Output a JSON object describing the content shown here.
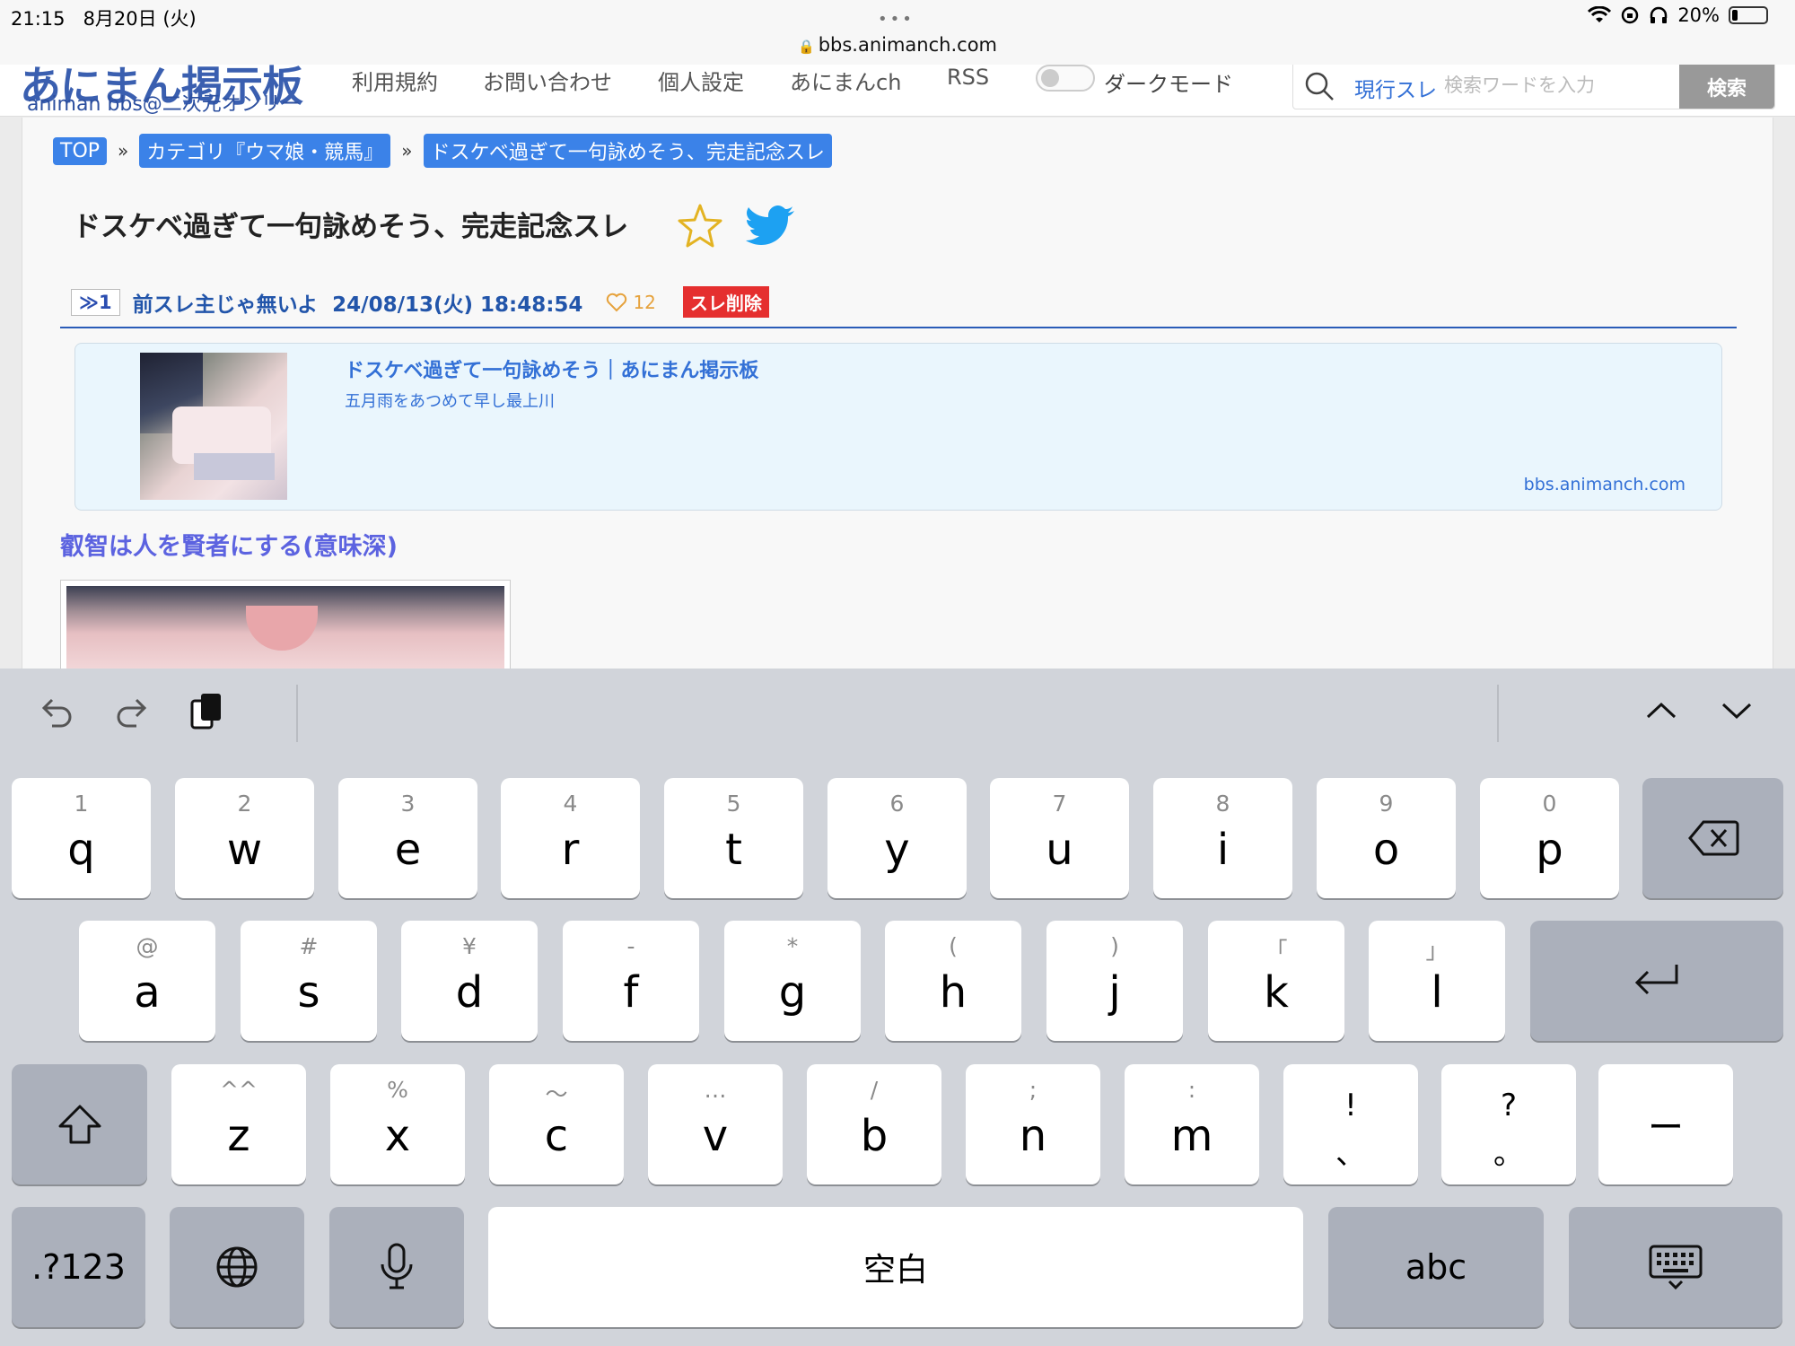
{
  "status_bar": {
    "time": "21:15",
    "date": "8月20日 (火)",
    "url": "bbs.animanch.com",
    "battery": "20%"
  },
  "site_header": {
    "logo": "あにまん掲示板",
    "logo_sub": "animan bbs@二次元オンリー",
    "nav": [
      "利用規約",
      "お問い合わせ",
      "個人設定",
      "あにまんch",
      "RSS"
    ],
    "dark_mode_label": "ダークモード",
    "search_scope": "現行スレ",
    "search_placeholder": "検索ワードを入力",
    "search_button": "検索"
  },
  "breadcrumbs": [
    "TOP",
    "カテゴリ『ウマ娘・競馬』",
    "ドスケベ過ぎて一句詠めそう、完走記念スレ"
  ],
  "breadcrumb_sep": "»",
  "thread": {
    "title": "ドスケベ過ぎて一句詠めそう、完走記念スレ",
    "post": {
      "number": "≫1",
      "author": "前スレ主じゃ無いよ",
      "datetime": "24/08/13(火) 18:48:54",
      "likes": "12",
      "delete_label": "スレ削除"
    },
    "link_card": {
      "title": "ドスケベ過ぎて一句詠めそう｜あにまん掲示板",
      "description": "五月雨をあつめて早し最上川",
      "domain": "bbs.animanch.com"
    },
    "quote": "叡智は人を賢者にする(意味深)"
  },
  "keyboard": {
    "row1": [
      {
        "sec": "1",
        "pri": "q"
      },
      {
        "sec": "2",
        "pri": "w"
      },
      {
        "sec": "3",
        "pri": "e"
      },
      {
        "sec": "4",
        "pri": "r"
      },
      {
        "sec": "5",
        "pri": "t"
      },
      {
        "sec": "6",
        "pri": "y"
      },
      {
        "sec": "7",
        "pri": "u"
      },
      {
        "sec": "8",
        "pri": "i"
      },
      {
        "sec": "9",
        "pri": "o"
      },
      {
        "sec": "0",
        "pri": "p"
      }
    ],
    "row2": [
      {
        "sec": "@",
        "pri": "a"
      },
      {
        "sec": "#",
        "pri": "s"
      },
      {
        "sec": "¥",
        "pri": "d"
      },
      {
        "sec": "-",
        "pri": "f"
      },
      {
        "sec": "*",
        "pri": "g"
      },
      {
        "sec": "(",
        "pri": "h"
      },
      {
        "sec": ")",
        "pri": "j"
      },
      {
        "sec": "「",
        "pri": "k"
      },
      {
        "sec": "」",
        "pri": "l"
      }
    ],
    "row3": [
      {
        "sec": "^^",
        "pri": "z"
      },
      {
        "sec": "%",
        "pri": "x"
      },
      {
        "sec": "〜",
        "pri": "c"
      },
      {
        "sec": "…",
        "pri": "v"
      },
      {
        "sec": "/",
        "pri": "b"
      },
      {
        "sec": ";",
        "pri": "n"
      },
      {
        "sec": ":",
        "pri": "m"
      },
      {
        "sec": "!",
        "pri": "、"
      },
      {
        "sec": "?",
        "pri": "。"
      }
    ],
    "dash_key": "ー",
    "numbers_key": ".?123",
    "space_key": "空白",
    "abc_key": "abc"
  },
  "colors": {
    "accent": "#3b82e8",
    "link": "#2255aa",
    "delete": "#e52f2f",
    "quote": "#5c63e0",
    "keyboard_bg": "#d1d4da"
  }
}
